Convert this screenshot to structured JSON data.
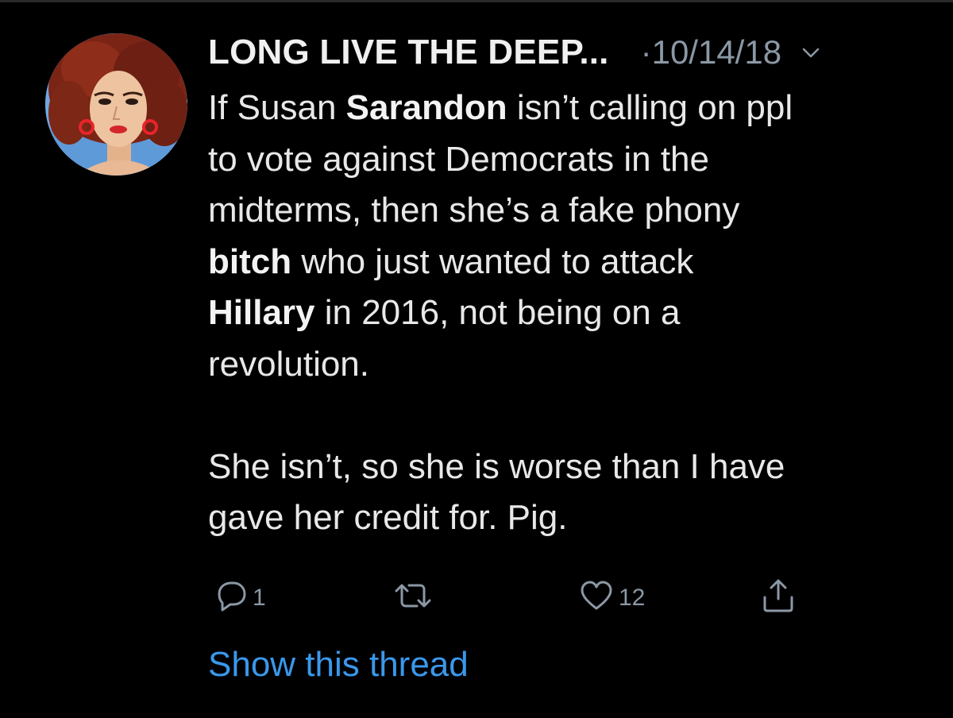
{
  "tweet": {
    "display_name": "LONG LIVE THE DEEP...",
    "date": "·10/14/18",
    "caret_icon": "chevron-down-icon",
    "text": {
      "l1a": "If Susan ",
      "l1b": "Sarandon",
      "l1c": " isn’t calling on ppl",
      "l2": "to vote against Democrats in the",
      "l3": "midterms, then she’s a fake phony",
      "l4a": "bitch",
      "l4b": " who just wanted to attack",
      "l5a": "Hillary",
      "l5b": " in 2016, not being on a",
      "l6": "revolution.",
      "p2l1": "She isn’t, so she is worse than I have",
      "p2l2": "gave her credit for. Pig."
    },
    "actions": {
      "reply_count": "1",
      "retweet_count": "",
      "like_count": "12"
    },
    "show_thread": "Show this thread"
  },
  "colors": {
    "background": "#000000",
    "text": "#e8e8e8",
    "muted": "#8b98a5",
    "link": "#3a98eb"
  }
}
